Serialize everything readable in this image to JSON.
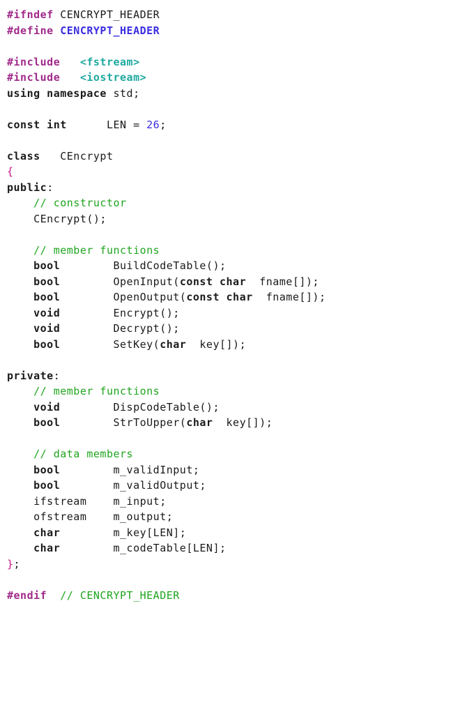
{
  "lines": [
    {
      "segs": [
        {
          "c": "directive",
          "t": "#ifndef "
        },
        {
          "c": "normal",
          "t": "CENCRYPT_HEADER"
        }
      ]
    },
    {
      "segs": [
        {
          "c": "directive",
          "t": "#define "
        },
        {
          "c": "macro",
          "t": "CENCRYPT_HEADER"
        }
      ]
    },
    {
      "segs": [
        {
          "c": "normal",
          "t": ""
        }
      ]
    },
    {
      "segs": [
        {
          "c": "directive",
          "t": "#include   "
        },
        {
          "c": "include",
          "t": "<fstream>"
        }
      ]
    },
    {
      "segs": [
        {
          "c": "directive",
          "t": "#include   "
        },
        {
          "c": "include",
          "t": "<iostream>"
        }
      ]
    },
    {
      "segs": [
        {
          "c": "keyword",
          "t": "using namespace "
        },
        {
          "c": "normal",
          "t": "std;"
        }
      ]
    },
    {
      "segs": [
        {
          "c": "normal",
          "t": ""
        }
      ]
    },
    {
      "segs": [
        {
          "c": "keyword",
          "t": "const int"
        },
        {
          "c": "normal",
          "t": "      LEN = "
        },
        {
          "c": "number",
          "t": "26"
        },
        {
          "c": "normal",
          "t": ";"
        }
      ]
    },
    {
      "segs": [
        {
          "c": "normal",
          "t": ""
        }
      ]
    },
    {
      "segs": [
        {
          "c": "keyword",
          "t": "class"
        },
        {
          "c": "normal",
          "t": "   CEncrypt"
        }
      ]
    },
    {
      "segs": [
        {
          "c": "brace",
          "t": "{"
        }
      ]
    },
    {
      "segs": [
        {
          "c": "keyword",
          "t": "public"
        },
        {
          "c": "normal",
          "t": ":"
        }
      ]
    },
    {
      "segs": [
        {
          "c": "normal",
          "t": "    "
        },
        {
          "c": "comment",
          "t": "// constructor"
        }
      ]
    },
    {
      "segs": [
        {
          "c": "normal",
          "t": "    CEncrypt();"
        }
      ]
    },
    {
      "segs": [
        {
          "c": "normal",
          "t": ""
        }
      ]
    },
    {
      "segs": [
        {
          "c": "normal",
          "t": "    "
        },
        {
          "c": "comment",
          "t": "// member functions"
        }
      ]
    },
    {
      "segs": [
        {
          "c": "normal",
          "t": "    "
        },
        {
          "c": "keyword",
          "t": "bool"
        },
        {
          "c": "normal",
          "t": "        BuildCodeTable();"
        }
      ]
    },
    {
      "segs": [
        {
          "c": "normal",
          "t": "    "
        },
        {
          "c": "keyword",
          "t": "bool"
        },
        {
          "c": "normal",
          "t": "        OpenInput("
        },
        {
          "c": "keyword",
          "t": "const char"
        },
        {
          "c": "normal",
          "t": "  fname[]);"
        }
      ]
    },
    {
      "segs": [
        {
          "c": "normal",
          "t": "    "
        },
        {
          "c": "keyword",
          "t": "bool"
        },
        {
          "c": "normal",
          "t": "        OpenOutput("
        },
        {
          "c": "keyword",
          "t": "const char"
        },
        {
          "c": "normal",
          "t": "  fname[]);"
        }
      ]
    },
    {
      "segs": [
        {
          "c": "normal",
          "t": "    "
        },
        {
          "c": "keyword",
          "t": "void"
        },
        {
          "c": "normal",
          "t": "        Encrypt();"
        }
      ]
    },
    {
      "segs": [
        {
          "c": "normal",
          "t": "    "
        },
        {
          "c": "keyword",
          "t": "void"
        },
        {
          "c": "normal",
          "t": "        Decrypt();"
        }
      ]
    },
    {
      "segs": [
        {
          "c": "normal",
          "t": "    "
        },
        {
          "c": "keyword",
          "t": "bool"
        },
        {
          "c": "normal",
          "t": "        SetKey("
        },
        {
          "c": "keyword",
          "t": "char"
        },
        {
          "c": "normal",
          "t": "  key[]);"
        }
      ]
    },
    {
      "segs": [
        {
          "c": "normal",
          "t": ""
        }
      ]
    },
    {
      "segs": [
        {
          "c": "keyword",
          "t": "private"
        },
        {
          "c": "normal",
          "t": ":"
        }
      ]
    },
    {
      "segs": [
        {
          "c": "normal",
          "t": "    "
        },
        {
          "c": "comment",
          "t": "// member functions"
        }
      ]
    },
    {
      "segs": [
        {
          "c": "normal",
          "t": "    "
        },
        {
          "c": "keyword",
          "t": "void"
        },
        {
          "c": "normal",
          "t": "        DispCodeTable();"
        }
      ]
    },
    {
      "segs": [
        {
          "c": "normal",
          "t": "    "
        },
        {
          "c": "keyword",
          "t": "bool"
        },
        {
          "c": "normal",
          "t": "        StrToUpper("
        },
        {
          "c": "keyword",
          "t": "char"
        },
        {
          "c": "normal",
          "t": "  key[]);"
        }
      ]
    },
    {
      "segs": [
        {
          "c": "normal",
          "t": ""
        }
      ]
    },
    {
      "segs": [
        {
          "c": "normal",
          "t": "    "
        },
        {
          "c": "comment",
          "t": "// data members"
        }
      ]
    },
    {
      "segs": [
        {
          "c": "normal",
          "t": "    "
        },
        {
          "c": "keyword",
          "t": "bool"
        },
        {
          "c": "normal",
          "t": "        m_validInput;"
        }
      ]
    },
    {
      "segs": [
        {
          "c": "normal",
          "t": "    "
        },
        {
          "c": "keyword",
          "t": "bool"
        },
        {
          "c": "normal",
          "t": "        m_validOutput;"
        }
      ]
    },
    {
      "segs": [
        {
          "c": "normal",
          "t": "    ifstream    m_input;"
        }
      ]
    },
    {
      "segs": [
        {
          "c": "normal",
          "t": "    ofstream    m_output;"
        }
      ]
    },
    {
      "segs": [
        {
          "c": "normal",
          "t": "    "
        },
        {
          "c": "keyword",
          "t": "char"
        },
        {
          "c": "normal",
          "t": "        m_key[LEN];"
        }
      ]
    },
    {
      "segs": [
        {
          "c": "normal",
          "t": "    "
        },
        {
          "c": "keyword",
          "t": "char"
        },
        {
          "c": "normal",
          "t": "        m_codeTable[LEN];"
        }
      ]
    },
    {
      "segs": [
        {
          "c": "brace",
          "t": "}"
        },
        {
          "c": "normal",
          "t": ";"
        }
      ]
    },
    {
      "segs": [
        {
          "c": "normal",
          "t": ""
        }
      ]
    },
    {
      "segs": [
        {
          "c": "directive",
          "t": "#endif"
        },
        {
          "c": "normal",
          "t": "  "
        },
        {
          "c": "comment",
          "t": "// CENCRYPT_HEADER"
        }
      ]
    }
  ]
}
